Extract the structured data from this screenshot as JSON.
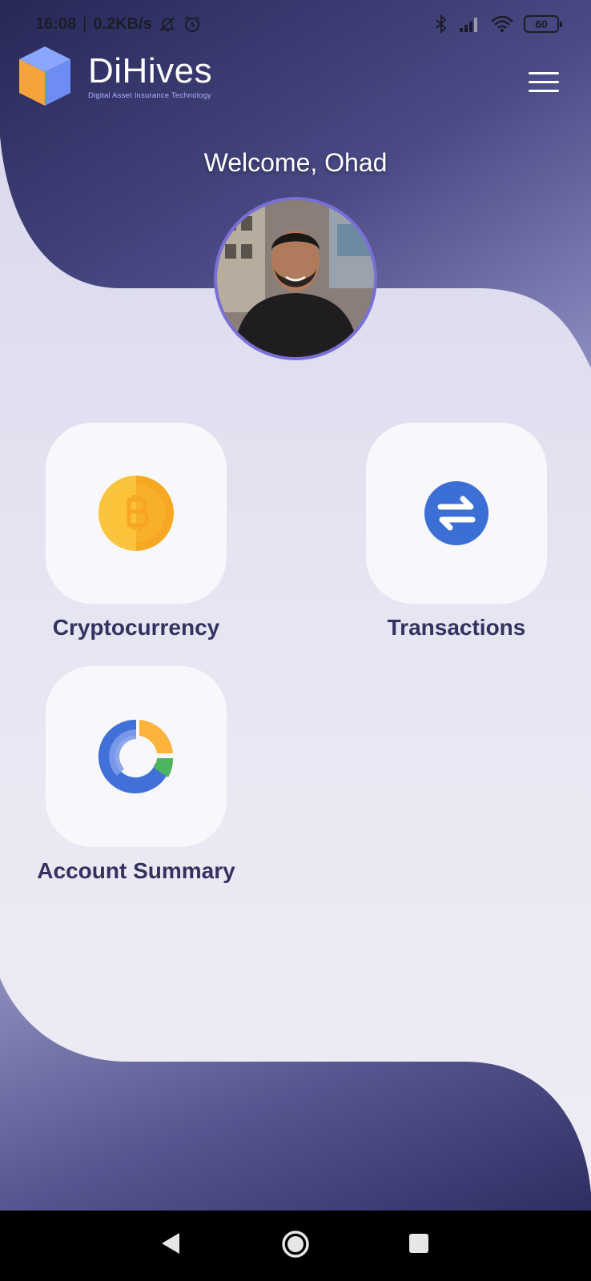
{
  "status_bar": {
    "time": "16:08",
    "separator": "|",
    "speed": "0.2KB/s",
    "battery": "60",
    "icons": [
      "mute-icon",
      "alarm-icon",
      "bluetooth-icon",
      "signal-icon",
      "wifi-icon",
      "battery-icon"
    ]
  },
  "header": {
    "app_name": "DiHives",
    "tagline": "Digital Asset Insurance Technology",
    "menu_icon": "hamburger-menu-icon"
  },
  "welcome": {
    "text": "Welcome, Ohad"
  },
  "tiles": [
    {
      "label": "Cryptocurrency",
      "icon": "bitcoin-icon"
    },
    {
      "label": "Transactions",
      "icon": "exchange-arrows-icon"
    },
    {
      "label": "Account Summary",
      "icon": "donut-chart-icon"
    }
  ],
  "colors": {
    "primary_dark": "#3b3a6e",
    "label_text": "#35315f",
    "avatar_ring": "#7a6fd6",
    "bitcoin": "#f7a823",
    "transactions": "#3c6fd6",
    "chart_blue": "#4170d8",
    "chart_orange": "#fbb33c",
    "chart_green": "#4cb45c"
  },
  "nav_bar": {
    "icons": [
      "back-icon",
      "home-icon",
      "recents-icon"
    ]
  }
}
